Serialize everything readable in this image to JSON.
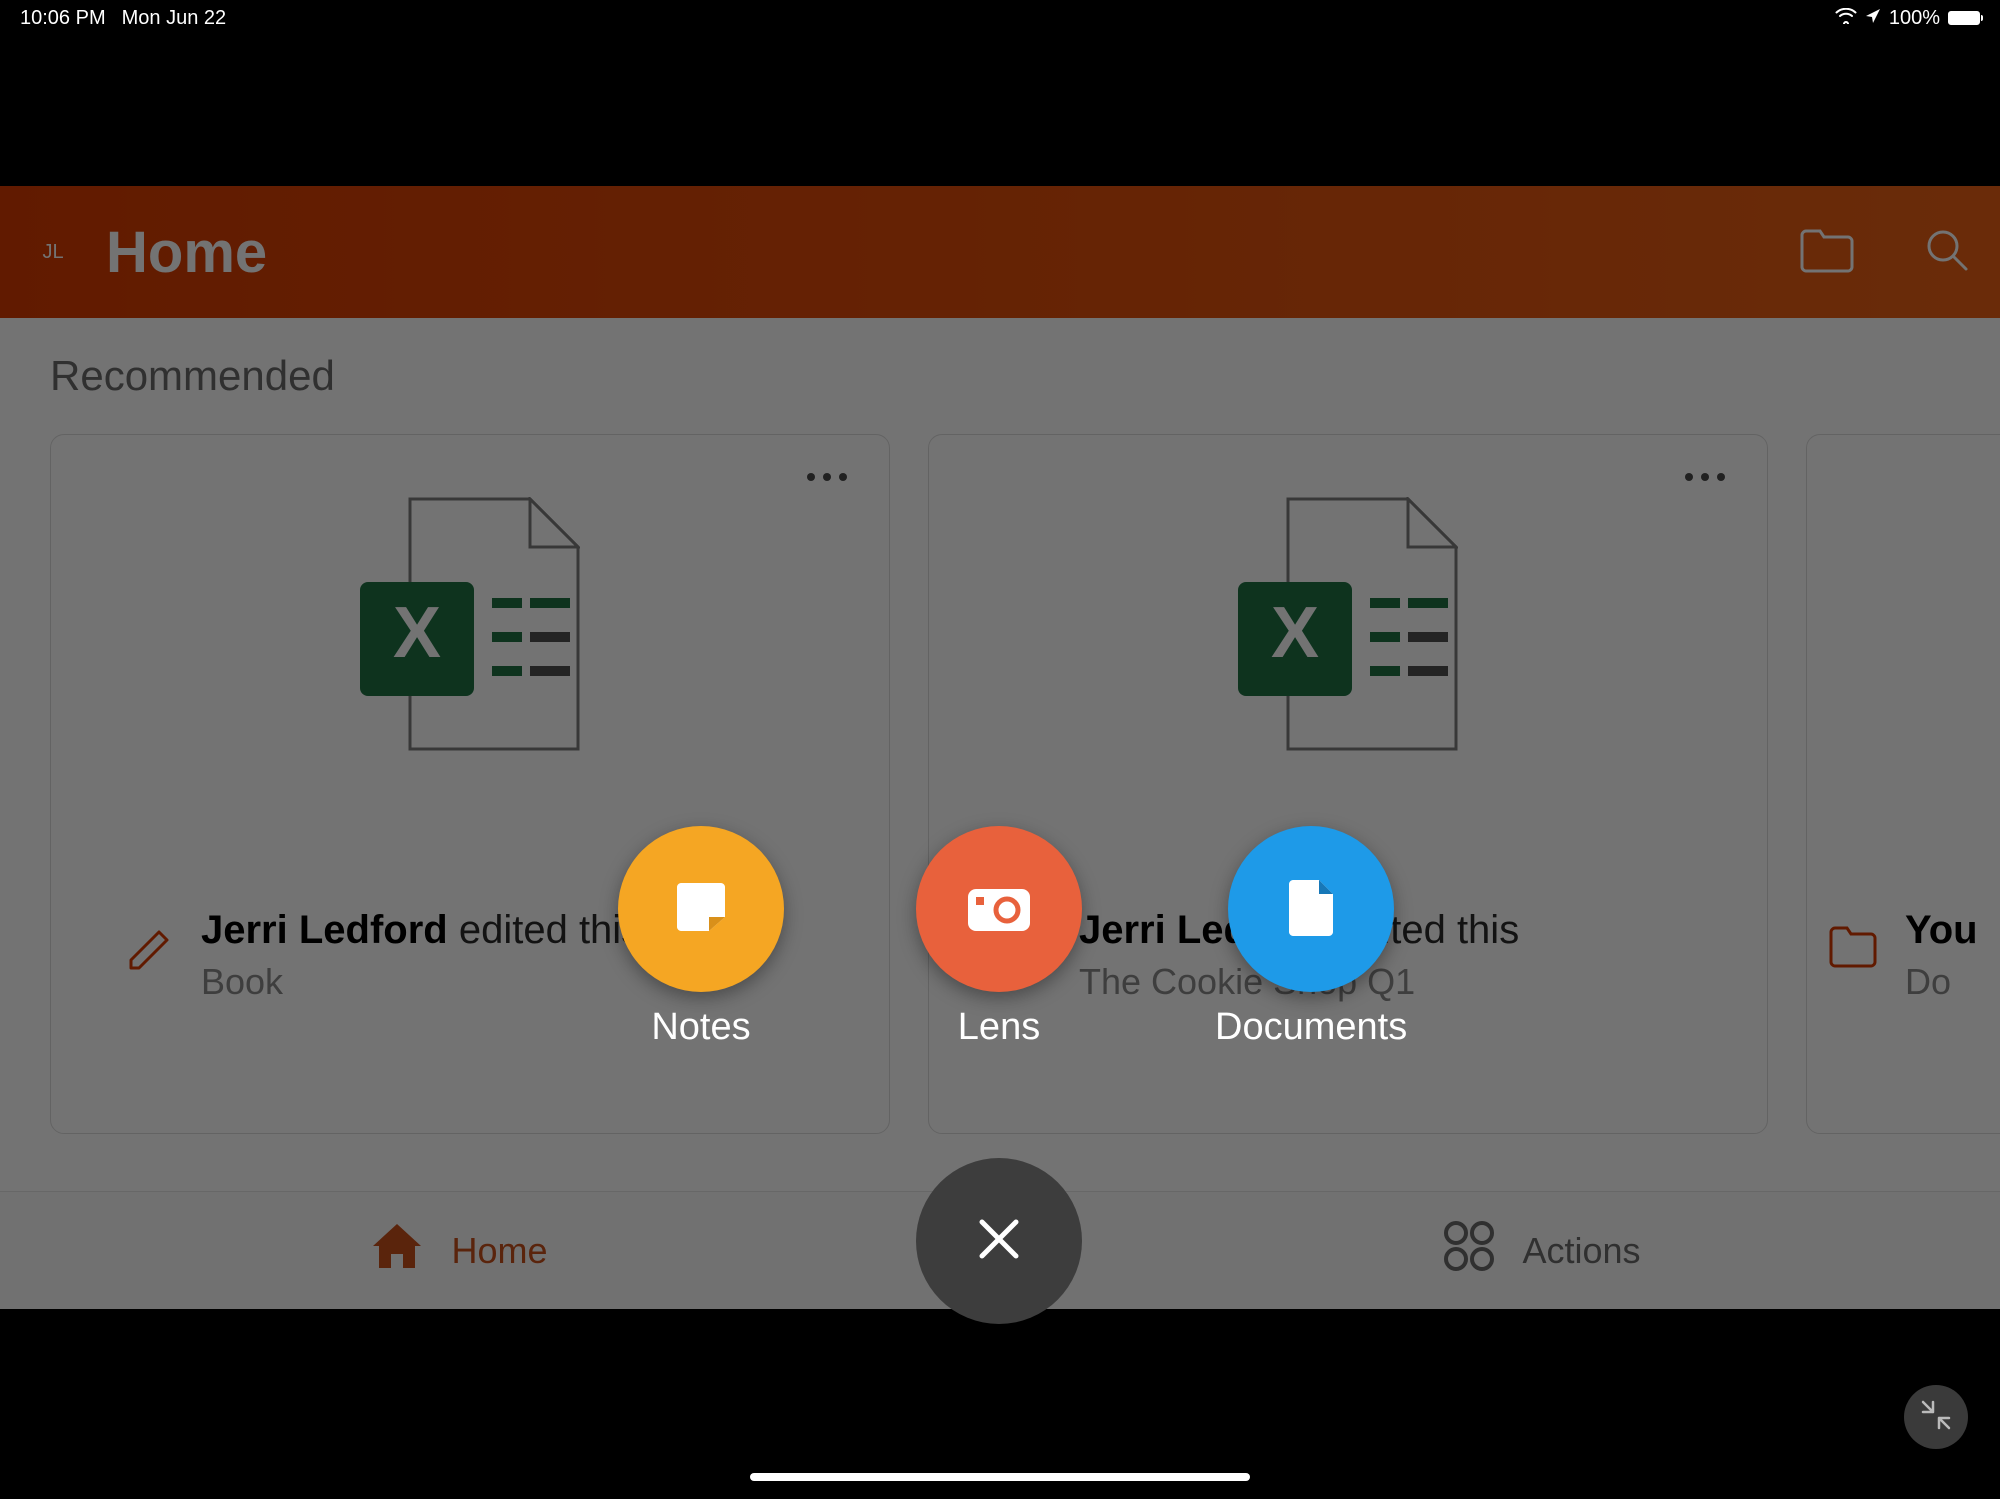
{
  "status_bar": {
    "time": "10:06 PM",
    "date": "Mon Jun 22",
    "battery": "100%"
  },
  "header": {
    "avatar_initials": "JL",
    "title": "Home"
  },
  "section": {
    "recommended_label": "Recommended"
  },
  "cards": [
    {
      "editor": "Jerri Ledford",
      "suffix": "edited this",
      "subtitle": "Book",
      "doc_type": "excel",
      "left_icon": "pencil"
    },
    {
      "editor": "Jerri Ledford",
      "suffix": "edited this",
      "subtitle": "The Cookie Shop Q1",
      "doc_type": "excel",
      "left_icon": "pencil"
    },
    {
      "editor": "You",
      "suffix": "",
      "subtitle": "Do",
      "doc_type": "folder",
      "left_icon": "folder"
    }
  ],
  "tabs": {
    "home": "Home",
    "actions": "Actions"
  },
  "fab": {
    "items": [
      {
        "key": "notes",
        "label": "Notes",
        "color": "#F5A623"
      },
      {
        "key": "lens",
        "label": "Lens",
        "color": "#E8613C"
      },
      {
        "key": "documents",
        "label": "Documents",
        "color": "#1E9AE8"
      }
    ],
    "close": "✕"
  }
}
